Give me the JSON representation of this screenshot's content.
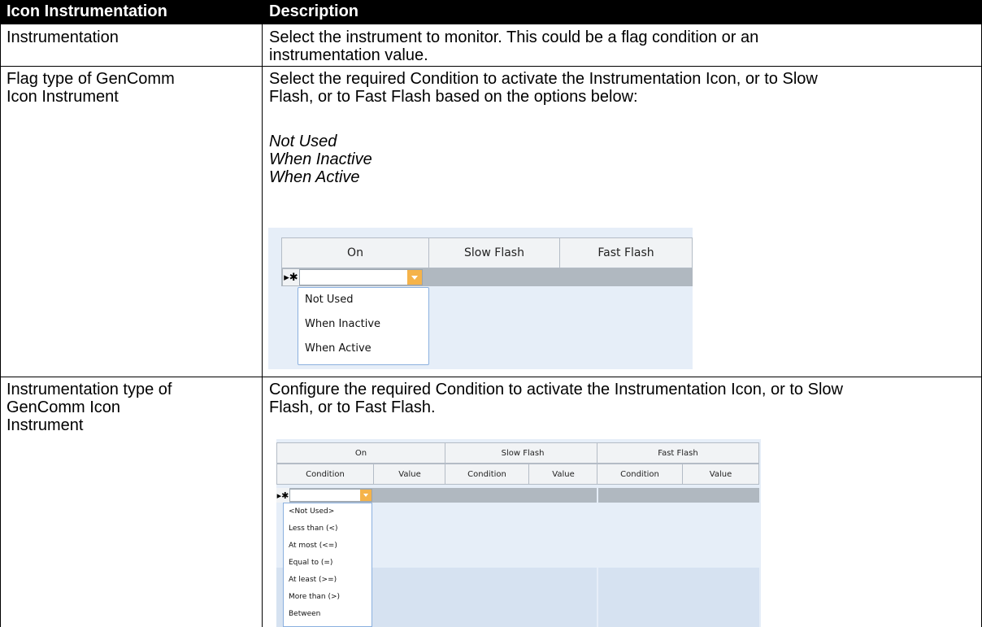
{
  "header": {
    "col1": "Icon Instrumentation",
    "col2": "Description"
  },
  "rows": [
    {
      "name": "Instrumentation",
      "desc_lines": [
        "Select the instrument to monitor. This could be a flag condition or an",
        "instrumentation value."
      ]
    },
    {
      "name_lines": [
        "Flag type of GenComm",
        "Icon Instrument"
      ],
      "desc_lines": [
        "Select the required Condition to activate the Instrumentation Icon, or to Slow",
        "Flash, or to Fast Flash based on the options below:"
      ],
      "options": [
        "Not Used",
        "When Inactive",
        "When Active"
      ]
    },
    {
      "name_lines": [
        "Instrumentation type of",
        "GenComm Icon",
        "Instrument"
      ],
      "desc_lines": [
        "Configure the required Condition to activate the Instrumentation Icon, or to Slow",
        "Flash, or to Fast Flash."
      ]
    }
  ],
  "grid1": {
    "columns": [
      "On",
      "Slow Flash",
      "Fast Flash"
    ],
    "new_row_marker": "▸✱",
    "dropdown_items": [
      "Not Used",
      "When Inactive",
      "When Active"
    ]
  },
  "grid2": {
    "groups": [
      "On",
      "Slow Flash",
      "Fast Flash"
    ],
    "subcolumns": [
      "Condition",
      "Value",
      "Condition",
      "Value",
      "Condition",
      "Value"
    ],
    "new_row_marker": "▸✱",
    "dropdown_items": [
      "<Not Used>",
      "Less than (<)",
      "At most (<=)",
      "Equal to (=)",
      "At least (>=)",
      "More than (>)",
      "Between"
    ]
  },
  "colors": {
    "header_bg": "#000000",
    "grid_bg": "#e6eef8",
    "grid_header": "#f1f3f5",
    "grid_row": "#b0b8c0",
    "dropdown_button": "#f5b34a",
    "dropdown_border": "#8bb0df"
  }
}
